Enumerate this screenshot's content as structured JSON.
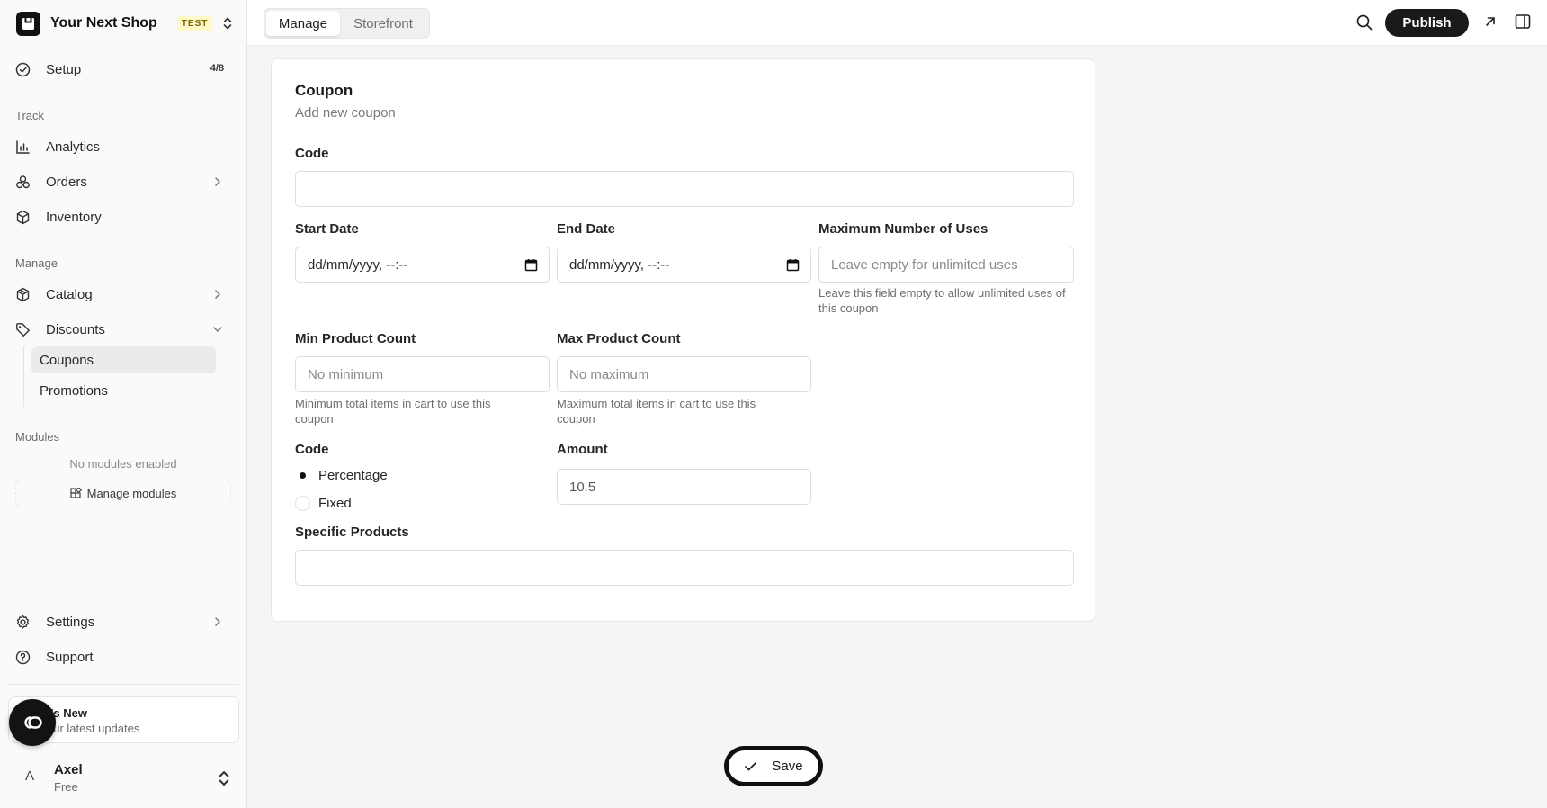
{
  "brand": {
    "name": "Your Next Shop",
    "badge": "TEST"
  },
  "sidebar": {
    "setup": {
      "label": "Setup",
      "count": "4/8"
    },
    "track_label": "Track",
    "track_items": [
      {
        "label": "Analytics",
        "icon": "chart-icon"
      },
      {
        "label": "Orders",
        "icon": "orders-icon"
      },
      {
        "label": "Inventory",
        "icon": "box-icon"
      }
    ],
    "manage_label": "Manage",
    "manage_items": [
      {
        "label": "Catalog",
        "icon": "catalog-icon"
      },
      {
        "label": "Discounts",
        "icon": "tag-icon"
      }
    ],
    "discount_sub": [
      {
        "label": "Coupons",
        "active": true
      },
      {
        "label": "Promotions",
        "active": false
      }
    ],
    "modules_label": "Modules",
    "no_modules": "No modules enabled",
    "manage_modules": "Manage modules",
    "bottom_items": [
      {
        "label": "Settings",
        "icon": "gear-icon"
      },
      {
        "label": "Support",
        "icon": "help-icon"
      }
    ],
    "whats_new": {
      "title": "t's New",
      "subtitle": "our latest updates"
    },
    "user": {
      "initial": "A",
      "name": "Axel",
      "plan": "Free"
    }
  },
  "topbar": {
    "tabs": [
      {
        "label": "Manage",
        "active": true
      },
      {
        "label": "Storefront",
        "active": false
      }
    ],
    "publish_label": "Publish"
  },
  "form": {
    "title": "Coupon",
    "subtitle": "Add new coupon",
    "code_label": "Code",
    "code_value": "",
    "start_label": "Start Date",
    "start_value": "dd/mm/yyyy, --:--",
    "end_label": "End Date",
    "end_value": "dd/mm/yyyy, --:--",
    "max_uses_label": "Maximum Number of Uses",
    "max_uses_placeholder": "Leave empty for unlimited uses",
    "max_uses_hint": "Leave this field empty to allow unlimited uses of this coupon",
    "min_label": "Min Product Count",
    "min_placeholder": "No minimum",
    "min_hint": "Minimum total items in cart to use this coupon",
    "max_label": "Max Product Count",
    "max_placeholder": "No maximum",
    "max_hint": "Maximum total items in cart to use this coupon",
    "type_label": "Code",
    "type_options": [
      {
        "label": "Percentage",
        "selected": true
      },
      {
        "label": "Fixed",
        "selected": false
      }
    ],
    "amount_label": "Amount",
    "amount_value": "10.5",
    "products_label": "Specific Products",
    "products_value": ""
  },
  "save_label": "Save"
}
